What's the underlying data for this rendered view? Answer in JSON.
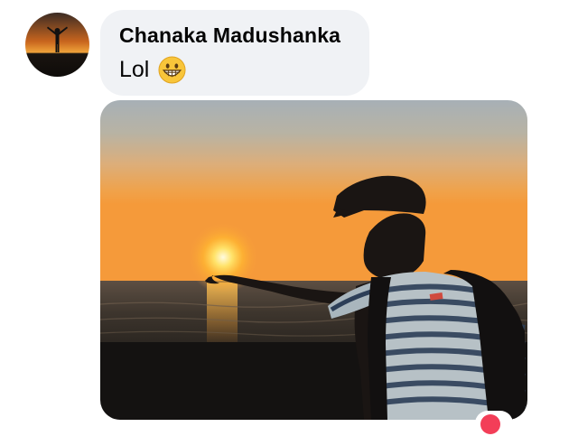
{
  "message": {
    "author": "Chanaka Madushanka",
    "text": "Lol",
    "emoji": "grinning-face-emoji"
  },
  "colors": {
    "bubble_bg": "#f0f2f5",
    "text": "#050505",
    "reaction": "#f33e58"
  },
  "reaction": {
    "icon": "heart-reaction-icon"
  }
}
